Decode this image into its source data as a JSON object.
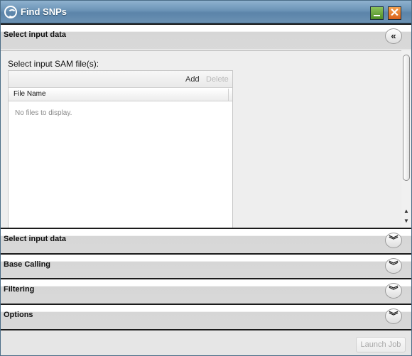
{
  "window": {
    "title": "Find SNPs",
    "minimize_icon": "minimize-icon",
    "close_icon": "close-icon",
    "close_glyph": "✕",
    "accent": "#5b84a9"
  },
  "sections": [
    {
      "label": "Select input data",
      "toggle": "«",
      "state": "expanded"
    },
    {
      "label": "Select input data",
      "toggle": "︾",
      "state": "collapsed"
    },
    {
      "label": "Base Calling",
      "toggle": "︾",
      "state": "collapsed"
    },
    {
      "label": "Filtering",
      "toggle": "︾",
      "state": "collapsed"
    },
    {
      "label": "Options",
      "toggle": "︾",
      "state": "collapsed"
    }
  ],
  "input": {
    "field_label": "Select input SAM file(s):",
    "toolbar": {
      "add": "Add",
      "delete": "Delete"
    },
    "columns": [
      "File Name"
    ],
    "empty_text": "No files to display."
  },
  "scrollbar": {
    "up": "▲",
    "down": "▼"
  },
  "footer": {
    "launch_label": "Launch Job"
  }
}
